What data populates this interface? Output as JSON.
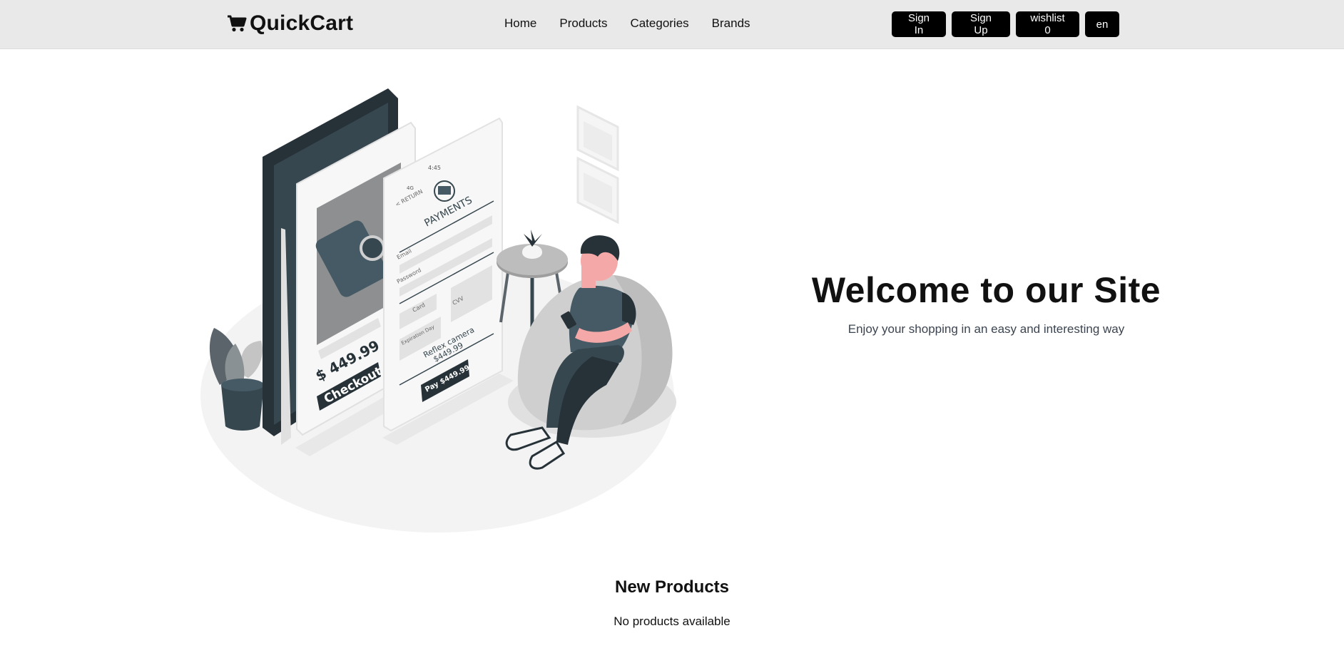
{
  "header": {
    "brand": "QuickCart",
    "nav": [
      "Home",
      "Products",
      "Categories",
      "Brands"
    ],
    "actions": {
      "sign_in": "Sign In",
      "sign_up": "Sign Up",
      "wishlist": "wishlist 0",
      "language": "en"
    }
  },
  "hero": {
    "title": "Welcome to our Site",
    "subtitle": "Enjoy your shopping in an easy and interesting way",
    "illustration": {
      "phone1_price": "$ 449.99",
      "phone1_button": "Checkout",
      "phone2_title": "PAYMENTS",
      "phone2_return": "< RETURN",
      "phone2_email": "Email",
      "phone2_password": "Password",
      "phone2_card": "Card",
      "phone2_cvv": "CVV",
      "phone2_expiry": "Expiration Day",
      "phone2_product": "Reflex camera",
      "phone2_price": "$449.99",
      "phone2_button": "Pay $449.99",
      "status_time": "4:45",
      "status_network": "4G"
    }
  },
  "new_products": {
    "title": "New Products",
    "empty_message": "No products available"
  },
  "colors": {
    "navbar_bg": "#e9e9e9",
    "button_bg": "#000000",
    "dark_slate": "#37474f",
    "skin": "#f4a9a8"
  }
}
